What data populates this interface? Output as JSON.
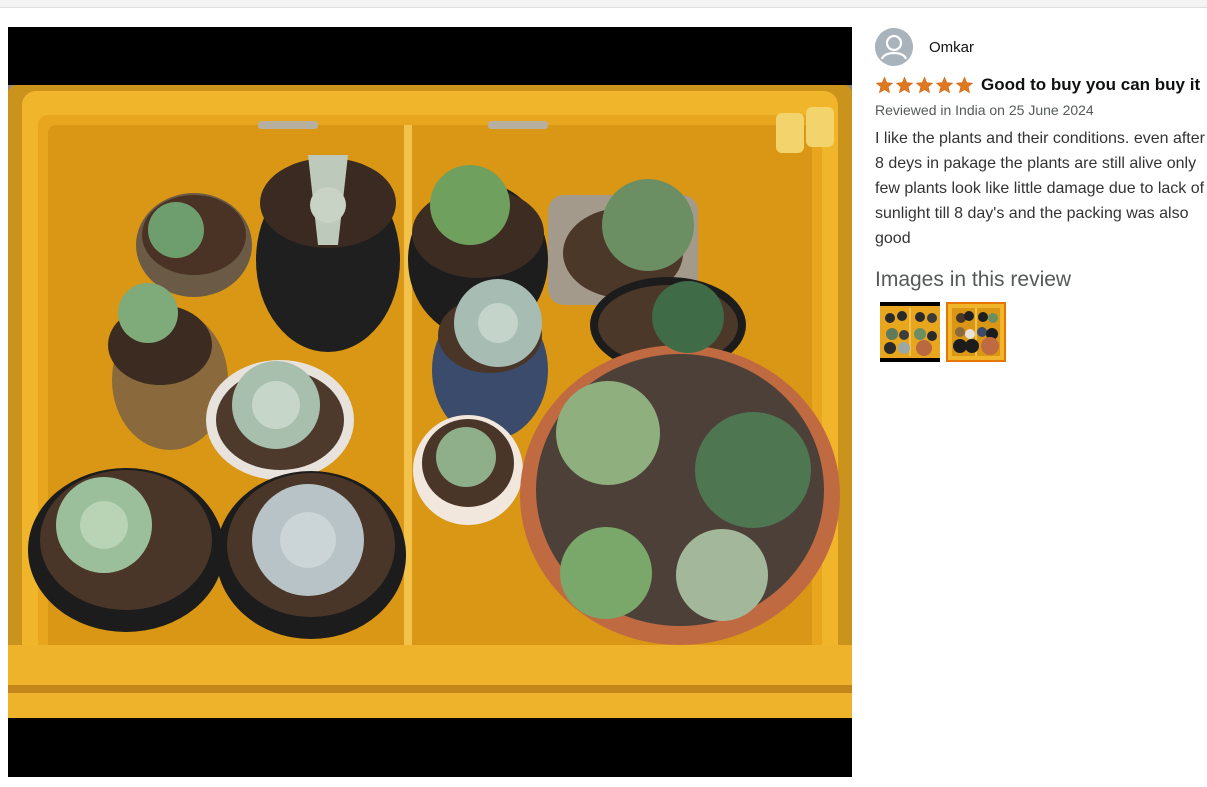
{
  "review": {
    "reviewer_name": "Omkar",
    "rating": 5,
    "title": "Good to buy you can buy it",
    "meta": "Reviewed in India on 25 June 2024",
    "body": "I like the plants and their conditions. even after 8 deys in pakage the plants are still alive only few plants look like little damage due to lack of sunlight till 8 day's and the packing was also good",
    "images_heading": "Images in this review"
  },
  "colors": {
    "star": "#de7921",
    "selected_border": "#e77600",
    "crate": "#f0b52a"
  },
  "icons": {
    "avatar": "person-silhouette-icon",
    "star": "star-icon"
  }
}
